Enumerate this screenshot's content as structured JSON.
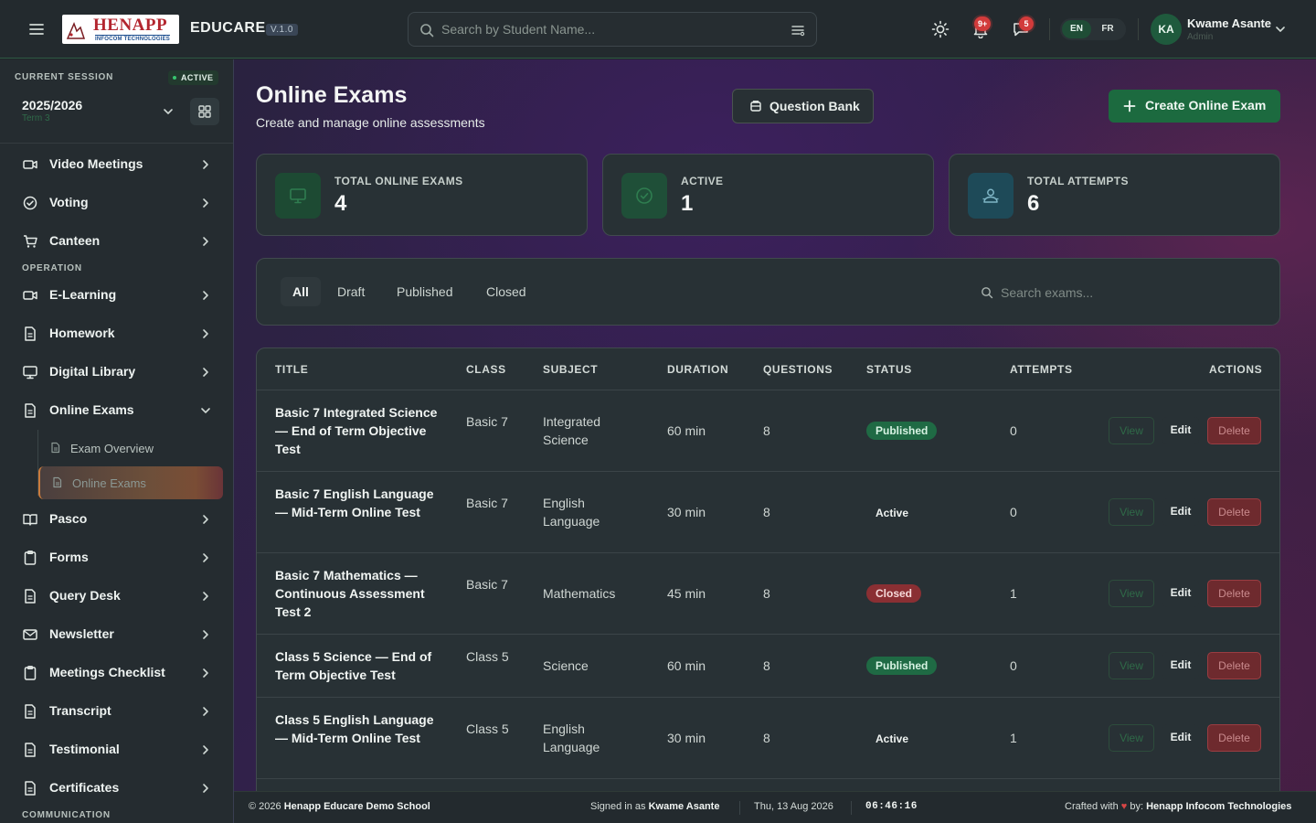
{
  "header": {
    "logo_line1": "HENAPP",
    "logo_line2": "INFOCOM TECHNOLOGIES",
    "app_name": "EDUCARE",
    "version": "V.1.0",
    "search_placeholder": "Search by Student Name...",
    "notifications_badge": "9+",
    "messages_badge": "5",
    "lang_en": "EN",
    "lang_fr": "FR",
    "user_initials": "KA",
    "user_name": "Kwame Asante",
    "user_role": "Admin"
  },
  "session": {
    "label": "CURRENT SESSION",
    "status": "ACTIVE",
    "year": "2025/2026",
    "term": "Term 3"
  },
  "sidebar": {
    "items_top": [
      {
        "label": "Video Meetings",
        "icon": "video-icon"
      },
      {
        "label": "Voting",
        "icon": "check-circle-icon"
      },
      {
        "label": "Canteen",
        "icon": "cart-icon"
      }
    ],
    "section_operation": "OPERATION",
    "items_operation": [
      {
        "label": "E-Learning",
        "icon": "video-icon"
      },
      {
        "label": "Homework",
        "icon": "document-icon"
      },
      {
        "label": "Digital Library",
        "icon": "monitor-icon"
      },
      {
        "label": "Online Exams",
        "icon": "document-icon"
      }
    ],
    "sub_items": [
      {
        "label": "Exam Overview"
      },
      {
        "label": "Online Exams"
      }
    ],
    "items_bottom": [
      {
        "label": "Pasco",
        "icon": "book-icon"
      },
      {
        "label": "Forms",
        "icon": "clipboard-icon"
      },
      {
        "label": "Query Desk",
        "icon": "document-icon"
      },
      {
        "label": "Newsletter",
        "icon": "mail-icon"
      },
      {
        "label": "Meetings Checklist",
        "icon": "clipboard-icon"
      },
      {
        "label": "Transcript",
        "icon": "document-icon"
      },
      {
        "label": "Testimonial",
        "icon": "document-icon"
      },
      {
        "label": "Certificates",
        "icon": "document-icon"
      }
    ],
    "section_communication": "COMMUNICATION"
  },
  "page": {
    "title": "Online Exams",
    "subtitle": "Create and manage online assessments",
    "question_bank_label": "Question Bank",
    "create_label": "Create Online Exam"
  },
  "stats": [
    {
      "label": "TOTAL ONLINE EXAMS",
      "value": "4",
      "icon": "monitor-icon",
      "color": "#1d4a33"
    },
    {
      "label": "ACTIVE",
      "value": "1",
      "icon": "check-circle-icon",
      "color": "#1f4f38"
    },
    {
      "label": "TOTAL ATTEMPTS",
      "value": "6",
      "icon": "users-icon",
      "color": "#1e4a58"
    }
  ],
  "filters": {
    "tabs": [
      "All",
      "Draft",
      "Published",
      "Closed"
    ],
    "active_tab": "All",
    "search_placeholder": "Search exams..."
  },
  "table": {
    "columns": [
      "TITLE",
      "CLASS",
      "SUBJECT",
      "DURATION",
      "QUESTIONS",
      "STATUS",
      "ATTEMPTS",
      "ACTIONS"
    ],
    "rows": [
      {
        "title": "Basic 7 Integrated Science — End of Term Objective Test",
        "class": "Basic 7",
        "subject": "Integrated Science",
        "duration": "60 min",
        "questions": "8",
        "status": "Published",
        "attempts": "0"
      },
      {
        "title": "Basic 7 English Language — Mid-Term Online Test",
        "class": "Basic 7",
        "subject": "English Language",
        "duration": "30 min",
        "questions": "8",
        "status": "Active",
        "attempts": "0"
      },
      {
        "title": "Basic 7 Mathematics — Continuous Assessment Test 2",
        "class": "Basic 7",
        "subject": "Mathematics",
        "duration": "45 min",
        "questions": "8",
        "status": "Closed",
        "attempts": "1"
      },
      {
        "title": "Class 5 Science — End of Term Objective Test",
        "class": "Class 5",
        "subject": "Science",
        "duration": "60 min",
        "questions": "8",
        "status": "Published",
        "attempts": "0"
      },
      {
        "title": "Class 5 English Language — Mid-Term Online Test",
        "class": "Class 5",
        "subject": "English Language",
        "duration": "30 min",
        "questions": "8",
        "status": "Active",
        "attempts": "1"
      }
    ],
    "action_view": "View",
    "action_edit": "Edit",
    "action_delete": "Delete"
  },
  "footer": {
    "copyright": "© 2026",
    "school": "Henapp Educare Demo School",
    "signed_in_prefix": "Signed in as",
    "signed_in_user": "Kwame Asante",
    "date": "Thu, 13 Aug 2026",
    "time": "06:46:16",
    "crafted_prefix": "Crafted with",
    "crafted_by": "by:",
    "company": "Henapp Infocom Technologies"
  }
}
